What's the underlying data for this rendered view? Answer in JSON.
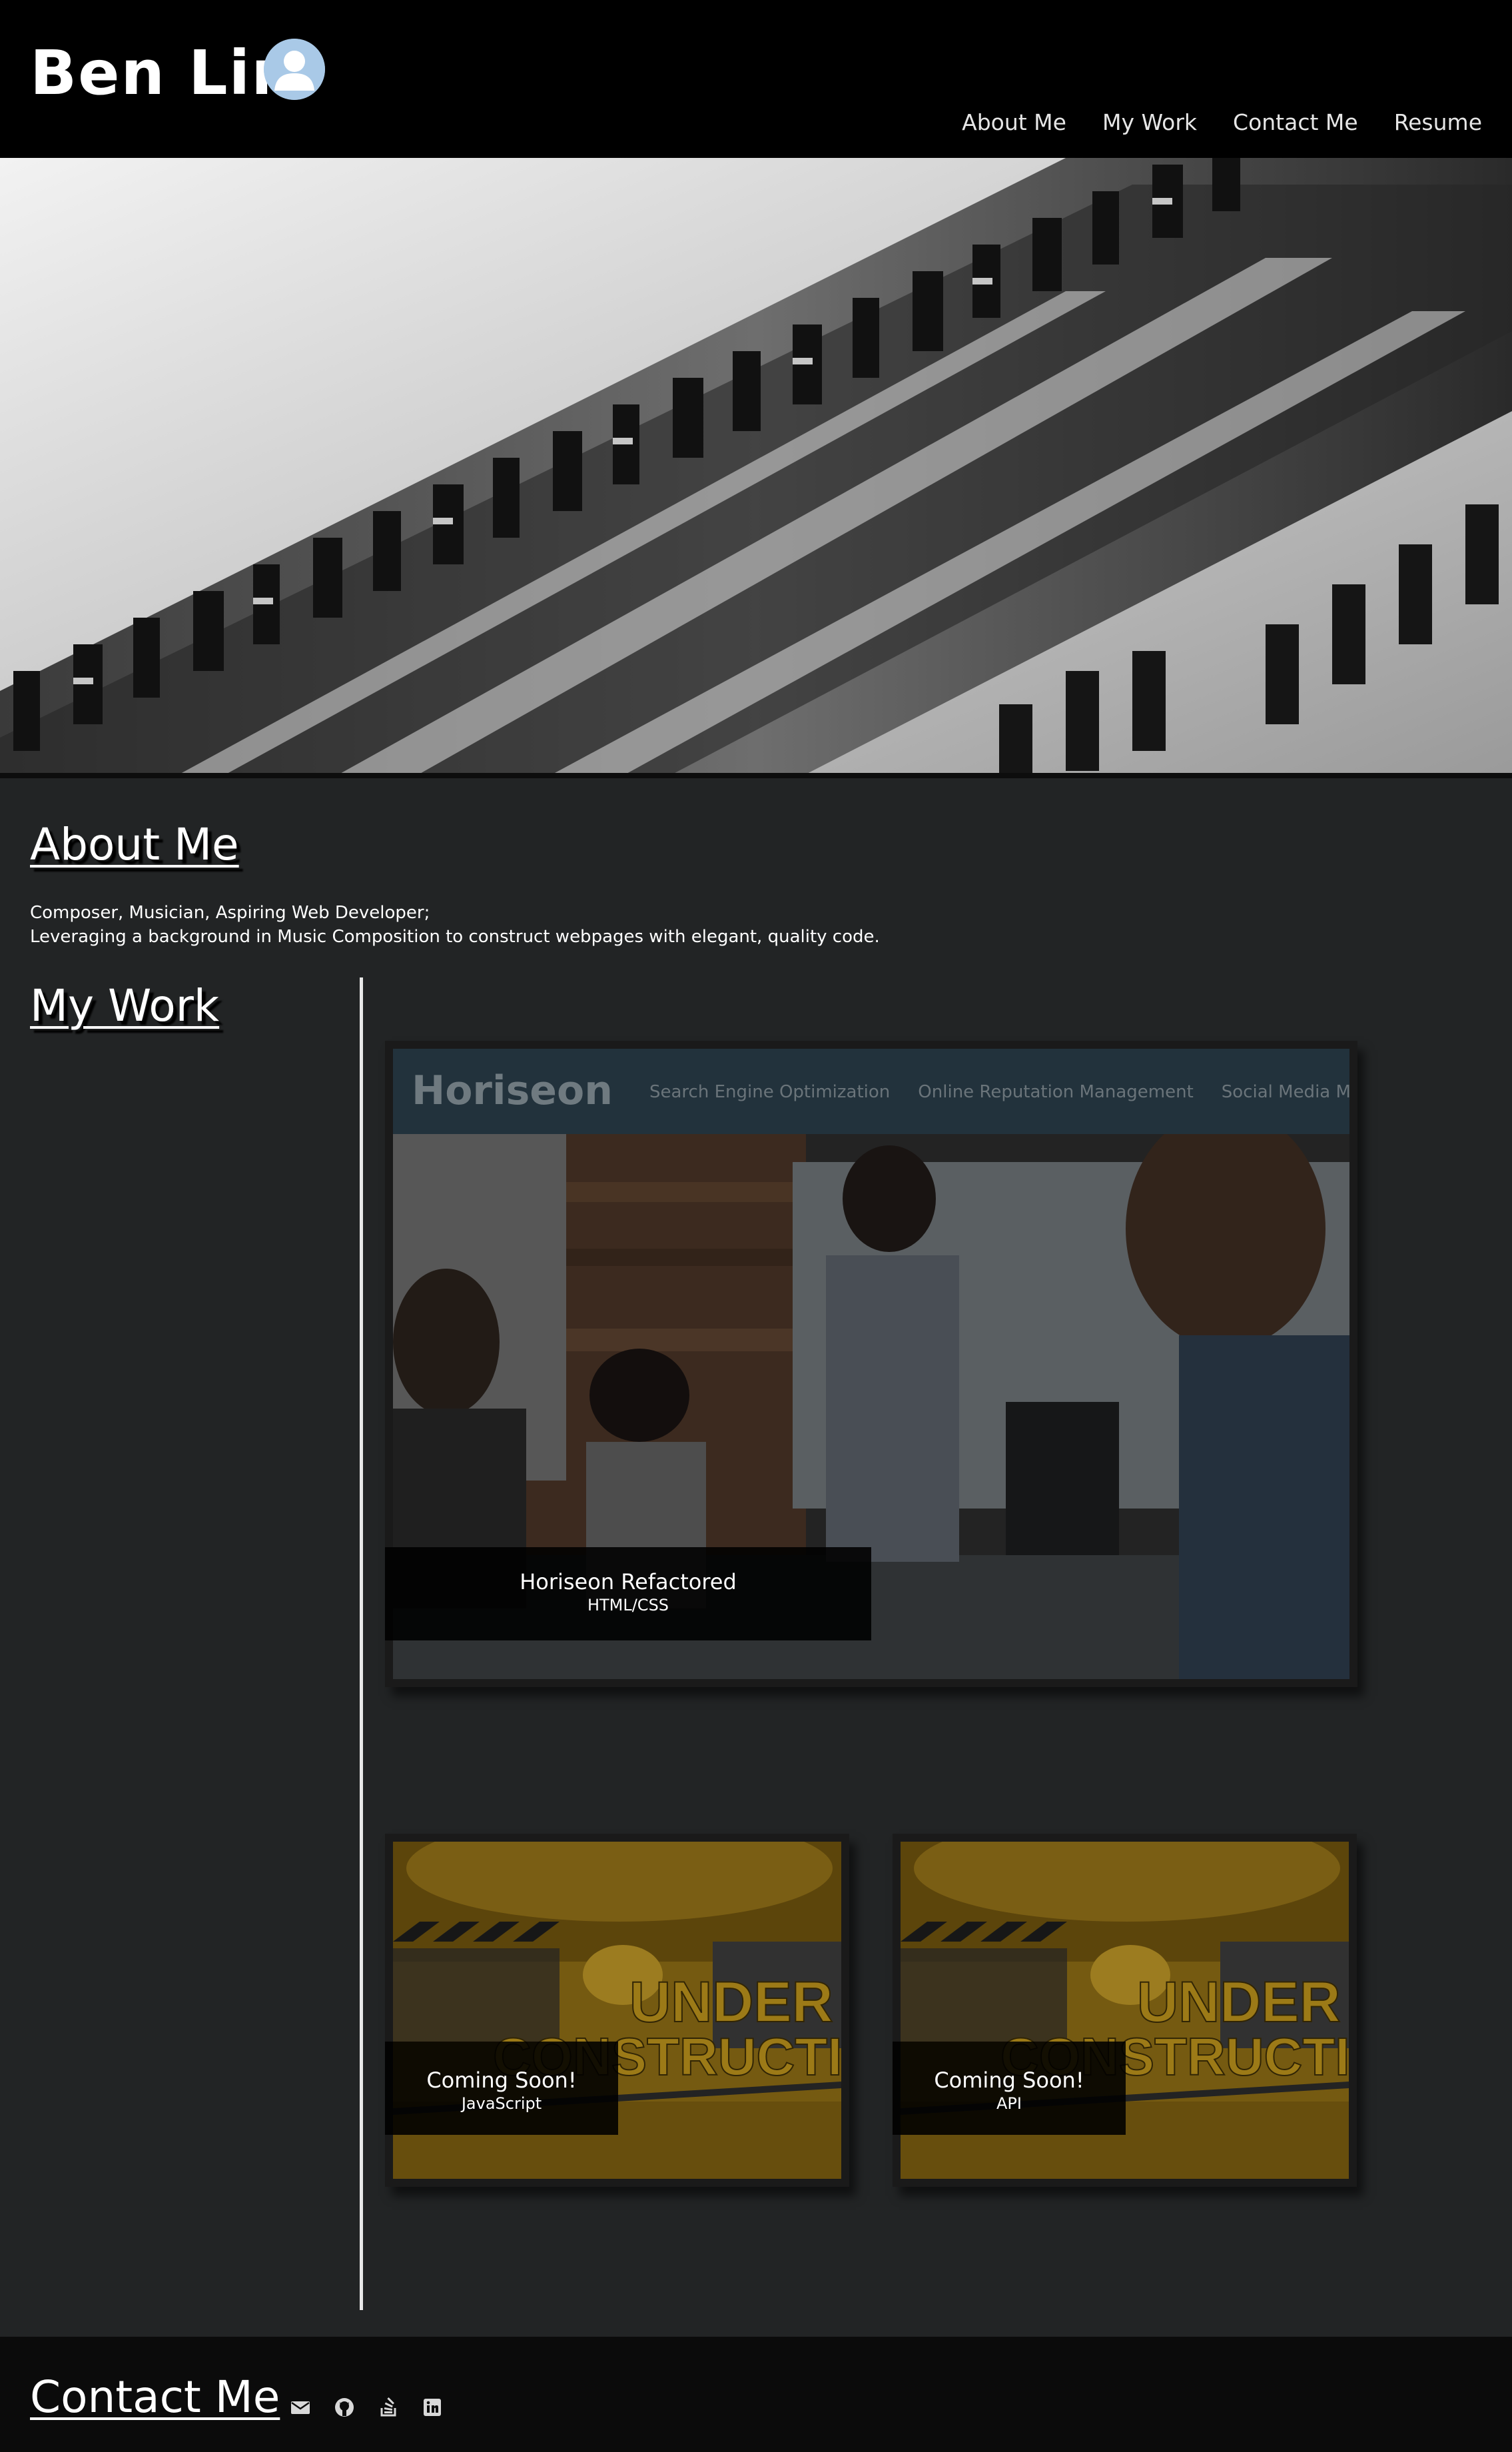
{
  "header": {
    "name": "Ben Lin",
    "nav": [
      "About Me",
      "My Work",
      "Contact Me",
      "Resume"
    ]
  },
  "about": {
    "heading": "About Me",
    "line1": "Composer, Musician, Aspiring Web Developer;",
    "line2": "Leveraging a background in Music Composition to construct webpages with elegant, quality code."
  },
  "work": {
    "heading": "My Work",
    "featured": {
      "title": "Horiseon Refactored",
      "subtitle": "HTML/CSS",
      "screenshot_logo": "Horiseon",
      "screenshot_nav": [
        "Search Engine Optimization",
        "Online Reputation Management",
        "Social Media Marketing"
      ]
    },
    "projects": [
      {
        "title": "Coming Soon!",
        "subtitle": "JavaScript",
        "banner": "UNDER CONSTRUCTION"
      },
      {
        "title": "Coming Soon!",
        "subtitle": "API",
        "banner": "UNDER CONSTRUCTION"
      }
    ]
  },
  "contact": {
    "heading": "Contact Me",
    "icons": [
      "email-icon",
      "github-icon",
      "stack-overflow-icon",
      "linkedin-icon"
    ]
  },
  "colors": {
    "header_bg": "#000000",
    "page_bg": "#222425",
    "footer_bg": "#0b0b0b",
    "avatar": "#a8c8e6",
    "construction": "#b8901c"
  }
}
